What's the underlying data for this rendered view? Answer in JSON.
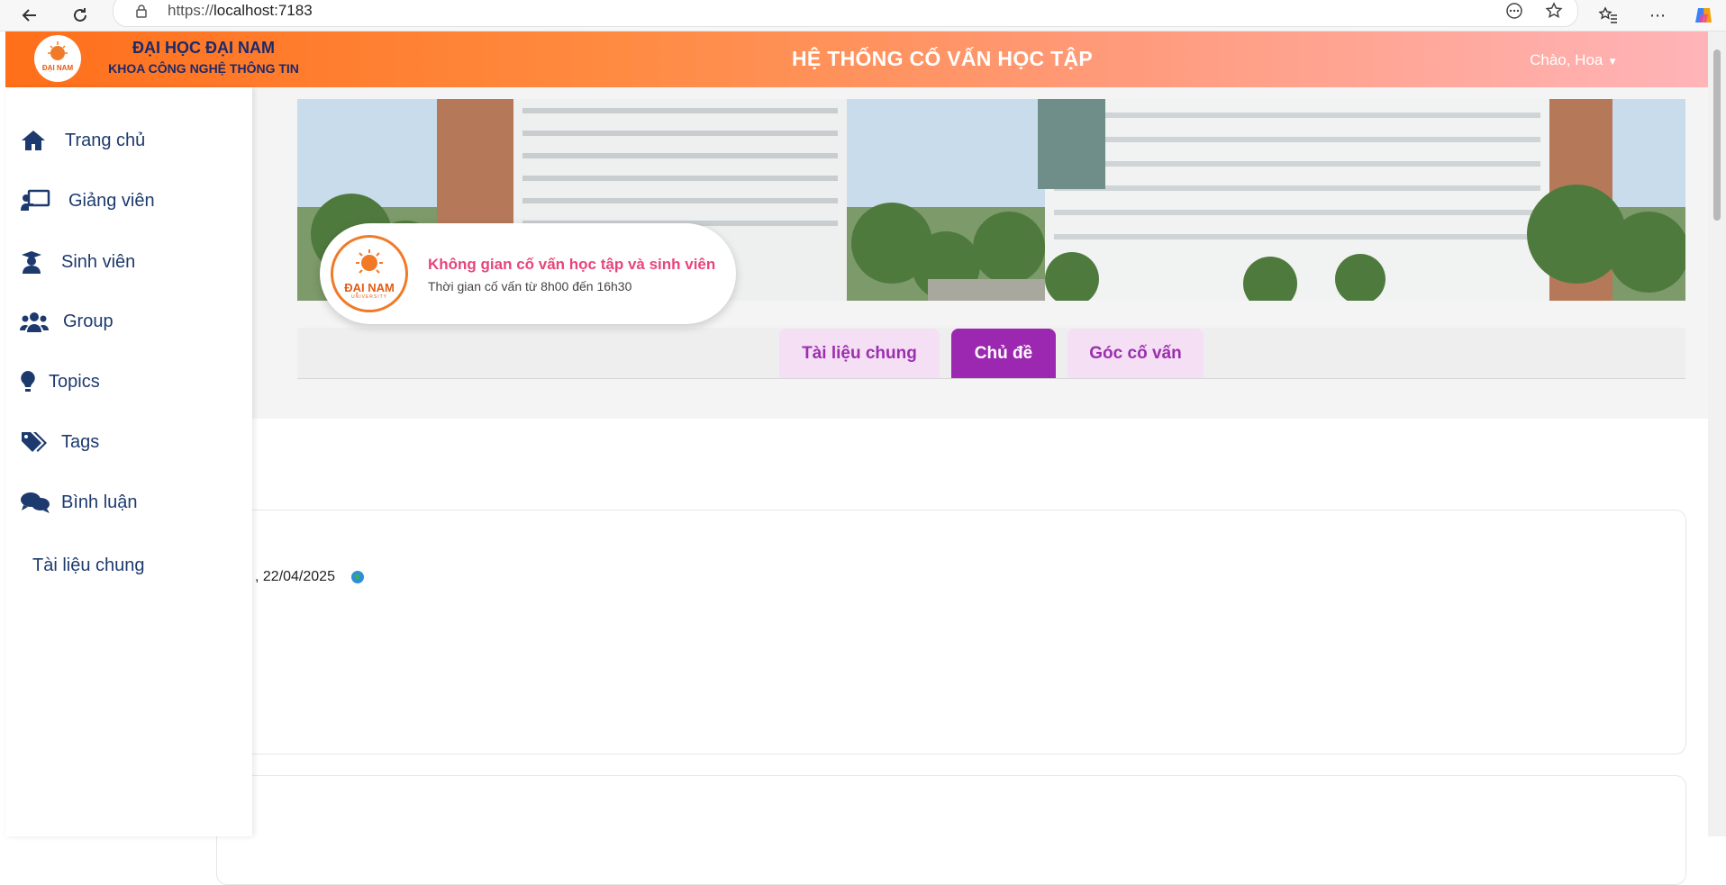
{
  "browser": {
    "url_prefix": "https://",
    "url_host": "localhost:7183"
  },
  "header": {
    "university_name": "ĐẠI HỌC ĐẠI NAM",
    "faculty_name": "KHOA CÔNG NGHỆ THÔNG TIN",
    "system_title": "HỆ THỐNG CỐ VẤN HỌC TẬP",
    "greeting": "Chào, Hoa",
    "logo_text": "ĐẠI NAM"
  },
  "sidebar": {
    "items": [
      {
        "label": "Trang chủ",
        "icon": "home-icon"
      },
      {
        "label": "Giảng viên",
        "icon": "chalkboard-teacher-icon"
      },
      {
        "label": "Sinh viên",
        "icon": "graduate-icon"
      },
      {
        "label": "Group",
        "icon": "users-icon"
      },
      {
        "label": "Topics",
        "icon": "lightbulb-icon"
      },
      {
        "label": "Tags",
        "icon": "tags-icon"
      },
      {
        "label": "Bình luận",
        "icon": "comments-icon"
      },
      {
        "label": "Tài liệu chung",
        "icon": ""
      }
    ]
  },
  "banner": {
    "card_title": "Không gian cố vấn học tập và sinh viên",
    "card_subtitle": "Thời gian cố vấn từ 8h00 đến 16h30",
    "logo_text": "ĐẠI NAM",
    "logo_subtext": "UNIVERSITY"
  },
  "tabs": [
    {
      "label": "Tài liệu chung",
      "active": false
    },
    {
      "label": "Chủ đề",
      "active": true
    },
    {
      "label": "Góc cố vấn",
      "active": false
    }
  ],
  "posts": [
    {
      "date_text": ", 22/04/2025"
    }
  ],
  "colors": {
    "accent_orange": "#ff6f1a",
    "tab_active": "#9c27b0",
    "card_title_pink": "#e8457a",
    "sidebar_text": "#1d3a6e"
  }
}
